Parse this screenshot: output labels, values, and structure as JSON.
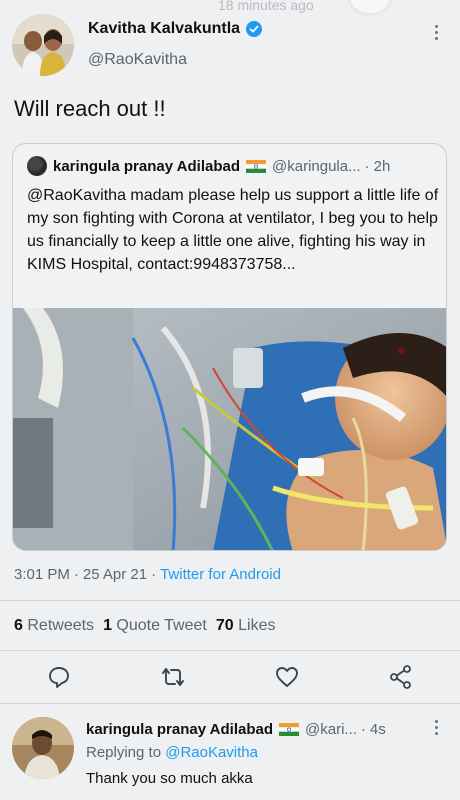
{
  "status": {
    "time_ago": "18 minutes ago"
  },
  "tweet": {
    "author_name": "Kavitha Kalvakuntla",
    "author_handle": "@RaoKavitha",
    "text": "Will reach out !!",
    "timestamp": "3:01 PM",
    "date": "25 Apr 21",
    "source": "Twitter for Android",
    "separator": "·"
  },
  "quoted": {
    "author_name": "karingula pranay Adilabad",
    "author_handle": "@karingula...",
    "time": "2h",
    "text": "@RaoKavitha madam please help us support a little life of my son fighting with Corona at ventilator, I beg you to help us financially to keep a little one alive, fighting his way in KIMS Hospital, contact:9948373758..."
  },
  "stats": {
    "retweets_count": "6",
    "retweets_label": "Retweets",
    "quote_count": "1",
    "quote_label": "Quote Tweet",
    "likes_count": "70",
    "likes_label": "Likes"
  },
  "reply": {
    "author_name": "karingula pranay Adilabad",
    "author_handle": "@kari...",
    "time": "4s",
    "replying_label": "Replying to",
    "replying_to": "@RaoKavitha",
    "text": "Thank you so much akka"
  },
  "icons": {
    "verified": "verified-badge-icon",
    "flag": "india-flag-icon",
    "reply": "reply-icon",
    "retweet": "retweet-icon",
    "like": "heart-icon",
    "share": "share-icon",
    "more": "more-vertical-icon"
  },
  "colors": {
    "accent": "#1d9bf0",
    "text": "#111111",
    "muted": "#5b6670",
    "background": "#eef0f1"
  }
}
